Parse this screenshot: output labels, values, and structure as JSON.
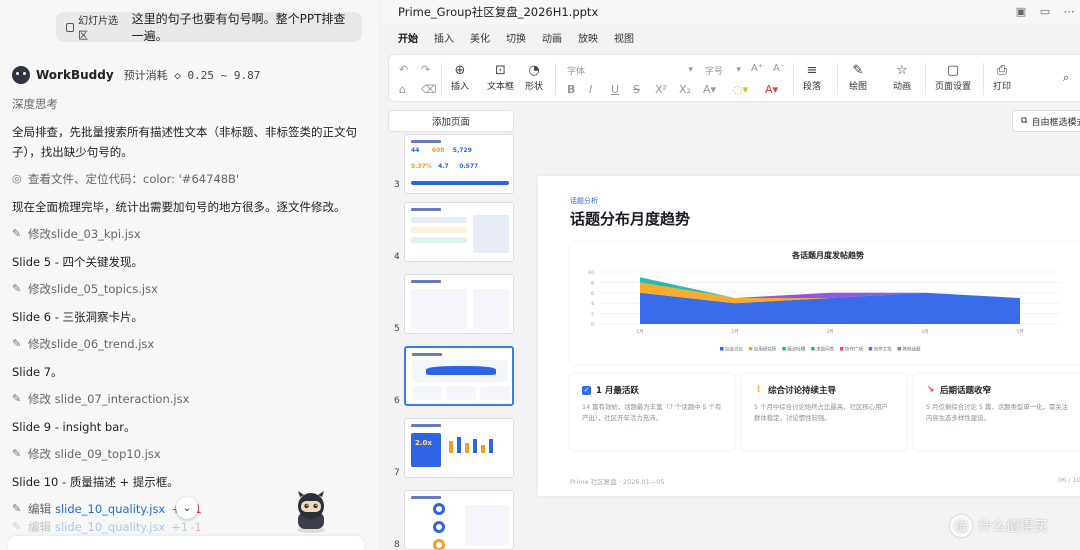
{
  "chat": {
    "user_chip": "幻灯片选区",
    "user_message": "这里的句子也要有句号啊。整个PPT排查一遍。",
    "bot_name": "WorkBuddy",
    "bot_cost": "预计消耗 ◇ 0.25 ~ 9.87",
    "thinking": "深度思考",
    "para1": "全局排查，先批量搜索所有描述性文本（非标题、非标签类的正文句子），找出缺少句号的。",
    "tool_view": "查看文件、定位代码：color: '#64748B'",
    "para2": "现在全面梳理完毕，统计出需要加句号的地方很多。逐文件修改。",
    "edit1": "修改slide_03_kpi.jsx",
    "s5": "Slide 5 - 四个关键发现。",
    "edit2": "修改slide_05_topics.jsx",
    "s6": "Slide 6 - 三张洞察卡片。",
    "edit3": "修改slide_06_trend.jsx",
    "s7": "Slide 7。",
    "edit4": "修改 slide_07_interaction.jsx",
    "s9": "Slide 9 - insight bar。",
    "edit5": "修改 slide_09_top10.jsx",
    "s10": "Slide 10 - 质量描述 + 提示框。",
    "edit6_label": "编辑",
    "edit6_file": "slide_10_quality.jsx",
    "edit6_add": "+1",
    "edit6_del": "-1",
    "edit7_label": "编辑",
    "edit7_file": "slide_10_quality.jsx",
    "edit7_add": "+1",
    "edit7_del": "-1"
  },
  "app": {
    "title": "Prime_Group社区复盘_2026H1.pptx",
    "tabs": [
      "开始",
      "插入",
      "美化",
      "切换",
      "动画",
      "放映",
      "视图"
    ],
    "ribbon": {
      "insert": "插入",
      "textbox": "文本框",
      "shape": "形状",
      "font_placeholder": "字体",
      "size_placeholder": "字号",
      "paragraph": "段落",
      "draw": "绘图",
      "animation": "动画",
      "page_setup": "页面设置",
      "print": "打印"
    },
    "add_page": "添加页面",
    "float_select": "自由框选模式",
    "thumb_numbers": [
      "3",
      "4",
      "5",
      "6",
      "7",
      "8"
    ]
  },
  "slide": {
    "tag": "话题分析",
    "title": "话题分布月度趋势",
    "cards": [
      {
        "title": "1 月最活跃",
        "body": "14 篇有效帖，话题最为丰富（7 个话题中 5 个有产出），社区开年活力充沛。",
        "color": "#2f6fe6",
        "icon": "check-icon"
      },
      {
        "title": "综合讨论持续主导",
        "body": "5 个月中综合讨论始终占比最高，社区核心用户群体稳定，讨论惯性较强。",
        "color": "#f0a020",
        "icon": "chart-icon"
      },
      {
        "title": "后期话题收窄",
        "body": "5 月仅剩综合讨论 5 篇，话题类型单一化，需关注内容生态多样性建设。",
        "color": "#e03a3a",
        "icon": "trend-down-icon"
      }
    ],
    "footer": "Prime 社区复盘 · 2026.01—05",
    "page": "06 / 10"
  },
  "chart_data": {
    "type": "area",
    "title": "各话题月度发帖趋势",
    "categories": [
      "1月",
      "2月",
      "3月",
      "4月",
      "5月"
    ],
    "ylim": [
      0,
      10
    ],
    "yticks": [
      0,
      2,
      4,
      6,
      8,
      10
    ],
    "stacked": true,
    "series": [
      {
        "name": "综合讨论",
        "color": "#2f64e8",
        "values": [
          6,
          4,
          5,
          6,
          5
        ]
      },
      {
        "name": "应用研究所",
        "color": "#f5a623",
        "values": [
          2,
          1,
          0,
          0,
          0
        ]
      },
      {
        "name": "痛点吐槽",
        "color": "#1fb5b0",
        "values": [
          1,
          0,
          0,
          0,
          0
        ]
      },
      {
        "name": "求助问答",
        "color": "#2fbd5e",
        "values": [
          0,
          0,
          0,
          0,
          0
        ]
      },
      {
        "name": "协作广场",
        "color": "#e8458f",
        "values": [
          0,
          0,
          0,
          0,
          0
        ]
      },
      {
        "name": "创作工坊",
        "color": "#8a4fd8",
        "values": [
          0,
          0,
          1,
          0,
          0
        ]
      },
      {
        "name": "其他话题",
        "color": "#7c8595",
        "values": [
          0,
          0,
          0,
          0,
          0
        ]
      }
    ],
    "grid": true,
    "legend": "bottom"
  },
  "watermark": "什么值得买"
}
